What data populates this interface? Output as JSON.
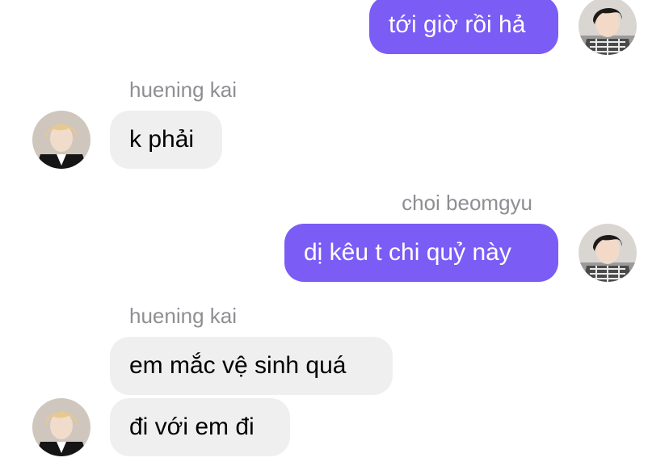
{
  "messages": [
    {
      "sender": "",
      "text": "tới giờ rồi hả"
    },
    {
      "sender": "huening kai",
      "text": "k phải"
    },
    {
      "sender": "choi beomgyu",
      "text": "dị kêu t chi quỷ này"
    },
    {
      "sender": "huening kai",
      "text": "em mắc vệ sinh quá"
    },
    {
      "sender": "",
      "text": "đi với em đi"
    }
  ],
  "avatars": {
    "self": "avatar-dark-hair-plaid",
    "other": "avatar-blond-hair-dark-suit"
  },
  "colors": {
    "outgoing_bubble": "#7b5cf5",
    "incoming_bubble": "#efefef",
    "sender_label": "#8e8e93"
  }
}
